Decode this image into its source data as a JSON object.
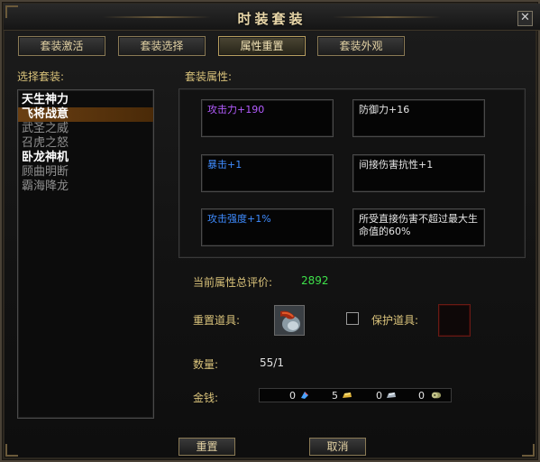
{
  "window": {
    "title": "时装套装",
    "close_icon": "close-icon"
  },
  "tabs": [
    {
      "label": "套装激活"
    },
    {
      "label": "套装选择"
    },
    {
      "label": "属性重置"
    },
    {
      "label": "套装外观"
    }
  ],
  "left": {
    "heading": "选择套装:",
    "suits": [
      {
        "name": "天生神力"
      },
      {
        "name": "飞将战意"
      },
      {
        "name": "武圣之威"
      },
      {
        "name": "召虎之怒"
      },
      {
        "name": "卧龙神机"
      },
      {
        "name": "顾曲明断"
      },
      {
        "name": "霸海降龙"
      }
    ]
  },
  "attributes": {
    "heading": "套装属性:",
    "items": [
      {
        "text": "攻击力+190"
      },
      {
        "text": "防御力+16"
      },
      {
        "text": "暴击+1"
      },
      {
        "text": "间接伤害抗性+1"
      },
      {
        "text": "攻击强度+1%"
      },
      {
        "text": "所受直接伤害不超过最大生命值的60%"
      }
    ]
  },
  "evaluation": {
    "label": "当前属性总评价:",
    "value": "2892"
  },
  "reset_item": {
    "label": "重置道具:",
    "icon": "reset-stone-icon"
  },
  "protect_item": {
    "label": "保护道具:"
  },
  "quantity": {
    "label": "数量:",
    "value": "55/1"
  },
  "money": {
    "label": "金钱:",
    "values": [
      "0",
      "5",
      "0",
      "0"
    ],
    "icons": [
      "gem-icon",
      "gold-ingot-icon",
      "silver-ingot-icon",
      "copper-coin-icon"
    ]
  },
  "buttons": {
    "reset": "重置",
    "cancel": "取消"
  },
  "colors": {
    "accent_gold": "#d9c27a",
    "evaluation_green": "#3ee04a",
    "attr_purple": "#b45cff",
    "attr_blue": "#3f8cff",
    "selected_row": "#6a3f12"
  }
}
